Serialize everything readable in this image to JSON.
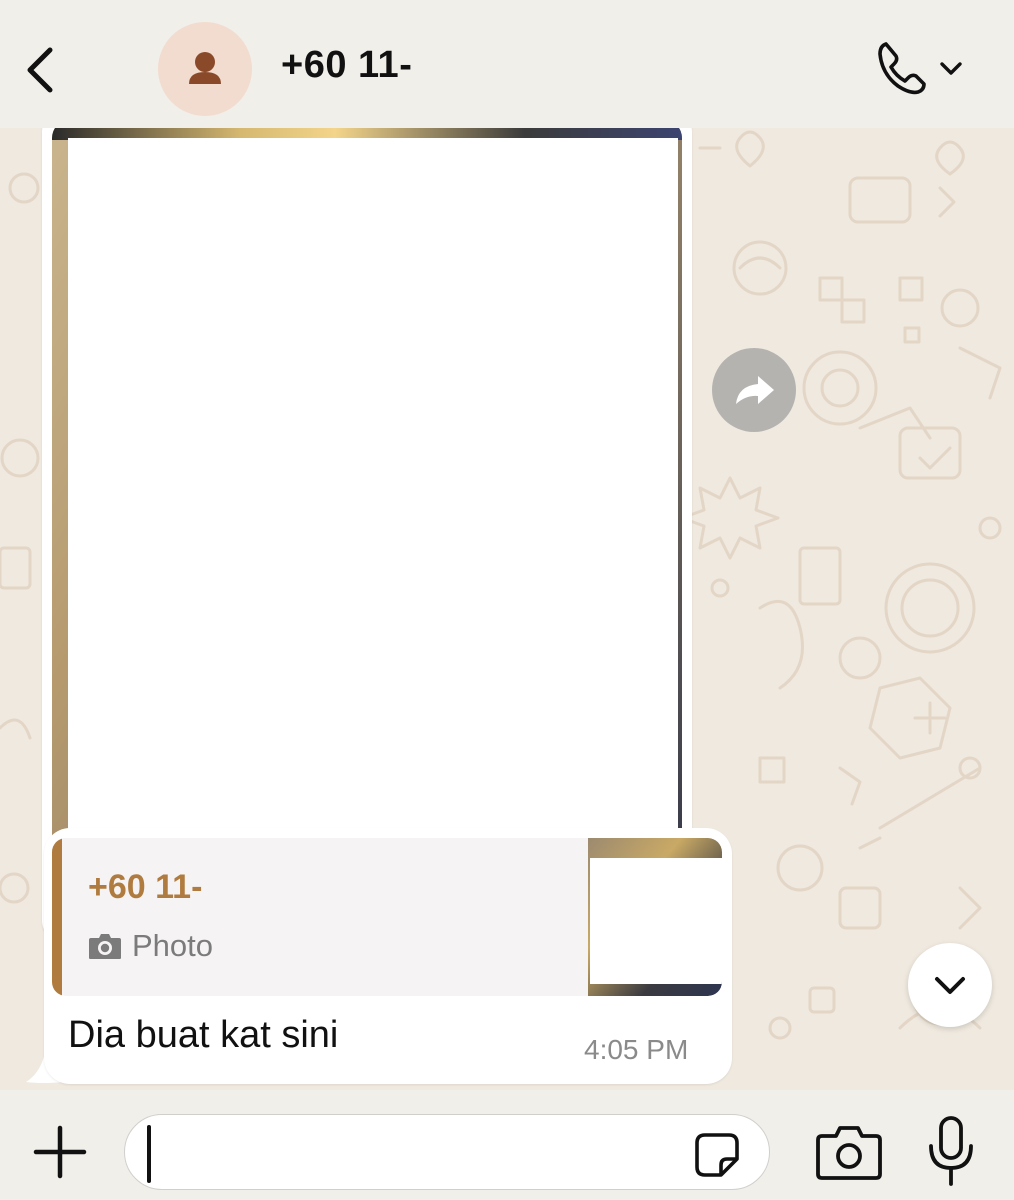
{
  "header": {
    "contact_name": "+60 11-",
    "back_icon": "chevron-left-icon",
    "avatar_icon": "person-icon",
    "call_icon": "phone-icon",
    "call_menu_icon": "chevron-down-icon"
  },
  "messages": {
    "image_message": {
      "type": "photo",
      "forward_icon": "forward-arrow-icon"
    },
    "reply_message": {
      "quoted": {
        "sender": "+60 11-",
        "type_label": "Photo",
        "type_icon": "camera-icon"
      },
      "text": "Dia buat kat sini",
      "time": "4:05 PM"
    }
  },
  "scroll_down_icon": "chevron-down-icon",
  "composer": {
    "attach_icon": "plus-icon",
    "input_value": "",
    "sticker_icon": "sticker-icon",
    "camera_icon": "camera-icon",
    "mic_icon": "microphone-icon"
  },
  "colors": {
    "header_bg": "#f1efea",
    "chat_bg": "#efe9df",
    "accent": "#b07b3e",
    "avatar_bg": "#f2dccf",
    "avatar_icon": "#8a4a2a"
  }
}
